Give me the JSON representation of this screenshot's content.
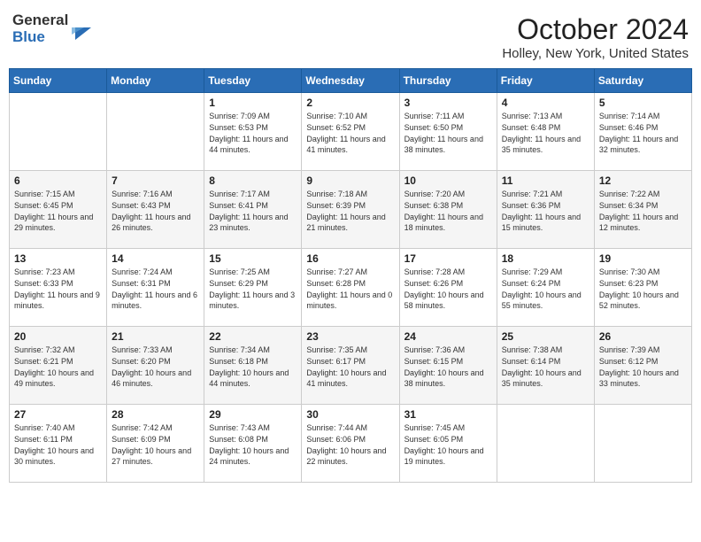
{
  "header": {
    "logo_general": "General",
    "logo_blue": "Blue",
    "month": "October 2024",
    "location": "Holley, New York, United States"
  },
  "weekdays": [
    "Sunday",
    "Monday",
    "Tuesday",
    "Wednesday",
    "Thursday",
    "Friday",
    "Saturday"
  ],
  "weeks": [
    [
      {
        "day": "",
        "sunrise": "",
        "sunset": "",
        "daylight": ""
      },
      {
        "day": "",
        "sunrise": "",
        "sunset": "",
        "daylight": ""
      },
      {
        "day": "1",
        "sunrise": "Sunrise: 7:09 AM",
        "sunset": "Sunset: 6:53 PM",
        "daylight": "Daylight: 11 hours and 44 minutes."
      },
      {
        "day": "2",
        "sunrise": "Sunrise: 7:10 AM",
        "sunset": "Sunset: 6:52 PM",
        "daylight": "Daylight: 11 hours and 41 minutes."
      },
      {
        "day": "3",
        "sunrise": "Sunrise: 7:11 AM",
        "sunset": "Sunset: 6:50 PM",
        "daylight": "Daylight: 11 hours and 38 minutes."
      },
      {
        "day": "4",
        "sunrise": "Sunrise: 7:13 AM",
        "sunset": "Sunset: 6:48 PM",
        "daylight": "Daylight: 11 hours and 35 minutes."
      },
      {
        "day": "5",
        "sunrise": "Sunrise: 7:14 AM",
        "sunset": "Sunset: 6:46 PM",
        "daylight": "Daylight: 11 hours and 32 minutes."
      }
    ],
    [
      {
        "day": "6",
        "sunrise": "Sunrise: 7:15 AM",
        "sunset": "Sunset: 6:45 PM",
        "daylight": "Daylight: 11 hours and 29 minutes."
      },
      {
        "day": "7",
        "sunrise": "Sunrise: 7:16 AM",
        "sunset": "Sunset: 6:43 PM",
        "daylight": "Daylight: 11 hours and 26 minutes."
      },
      {
        "day": "8",
        "sunrise": "Sunrise: 7:17 AM",
        "sunset": "Sunset: 6:41 PM",
        "daylight": "Daylight: 11 hours and 23 minutes."
      },
      {
        "day": "9",
        "sunrise": "Sunrise: 7:18 AM",
        "sunset": "Sunset: 6:39 PM",
        "daylight": "Daylight: 11 hours and 21 minutes."
      },
      {
        "day": "10",
        "sunrise": "Sunrise: 7:20 AM",
        "sunset": "Sunset: 6:38 PM",
        "daylight": "Daylight: 11 hours and 18 minutes."
      },
      {
        "day": "11",
        "sunrise": "Sunrise: 7:21 AM",
        "sunset": "Sunset: 6:36 PM",
        "daylight": "Daylight: 11 hours and 15 minutes."
      },
      {
        "day": "12",
        "sunrise": "Sunrise: 7:22 AM",
        "sunset": "Sunset: 6:34 PM",
        "daylight": "Daylight: 11 hours and 12 minutes."
      }
    ],
    [
      {
        "day": "13",
        "sunrise": "Sunrise: 7:23 AM",
        "sunset": "Sunset: 6:33 PM",
        "daylight": "Daylight: 11 hours and 9 minutes."
      },
      {
        "day": "14",
        "sunrise": "Sunrise: 7:24 AM",
        "sunset": "Sunset: 6:31 PM",
        "daylight": "Daylight: 11 hours and 6 minutes."
      },
      {
        "day": "15",
        "sunrise": "Sunrise: 7:25 AM",
        "sunset": "Sunset: 6:29 PM",
        "daylight": "Daylight: 11 hours and 3 minutes."
      },
      {
        "day": "16",
        "sunrise": "Sunrise: 7:27 AM",
        "sunset": "Sunset: 6:28 PM",
        "daylight": "Daylight: 11 hours and 0 minutes."
      },
      {
        "day": "17",
        "sunrise": "Sunrise: 7:28 AM",
        "sunset": "Sunset: 6:26 PM",
        "daylight": "Daylight: 10 hours and 58 minutes."
      },
      {
        "day": "18",
        "sunrise": "Sunrise: 7:29 AM",
        "sunset": "Sunset: 6:24 PM",
        "daylight": "Daylight: 10 hours and 55 minutes."
      },
      {
        "day": "19",
        "sunrise": "Sunrise: 7:30 AM",
        "sunset": "Sunset: 6:23 PM",
        "daylight": "Daylight: 10 hours and 52 minutes."
      }
    ],
    [
      {
        "day": "20",
        "sunrise": "Sunrise: 7:32 AM",
        "sunset": "Sunset: 6:21 PM",
        "daylight": "Daylight: 10 hours and 49 minutes."
      },
      {
        "day": "21",
        "sunrise": "Sunrise: 7:33 AM",
        "sunset": "Sunset: 6:20 PM",
        "daylight": "Daylight: 10 hours and 46 minutes."
      },
      {
        "day": "22",
        "sunrise": "Sunrise: 7:34 AM",
        "sunset": "Sunset: 6:18 PM",
        "daylight": "Daylight: 10 hours and 44 minutes."
      },
      {
        "day": "23",
        "sunrise": "Sunrise: 7:35 AM",
        "sunset": "Sunset: 6:17 PM",
        "daylight": "Daylight: 10 hours and 41 minutes."
      },
      {
        "day": "24",
        "sunrise": "Sunrise: 7:36 AM",
        "sunset": "Sunset: 6:15 PM",
        "daylight": "Daylight: 10 hours and 38 minutes."
      },
      {
        "day": "25",
        "sunrise": "Sunrise: 7:38 AM",
        "sunset": "Sunset: 6:14 PM",
        "daylight": "Daylight: 10 hours and 35 minutes."
      },
      {
        "day": "26",
        "sunrise": "Sunrise: 7:39 AM",
        "sunset": "Sunset: 6:12 PM",
        "daylight": "Daylight: 10 hours and 33 minutes."
      }
    ],
    [
      {
        "day": "27",
        "sunrise": "Sunrise: 7:40 AM",
        "sunset": "Sunset: 6:11 PM",
        "daylight": "Daylight: 10 hours and 30 minutes."
      },
      {
        "day": "28",
        "sunrise": "Sunrise: 7:42 AM",
        "sunset": "Sunset: 6:09 PM",
        "daylight": "Daylight: 10 hours and 27 minutes."
      },
      {
        "day": "29",
        "sunrise": "Sunrise: 7:43 AM",
        "sunset": "Sunset: 6:08 PM",
        "daylight": "Daylight: 10 hours and 24 minutes."
      },
      {
        "day": "30",
        "sunrise": "Sunrise: 7:44 AM",
        "sunset": "Sunset: 6:06 PM",
        "daylight": "Daylight: 10 hours and 22 minutes."
      },
      {
        "day": "31",
        "sunrise": "Sunrise: 7:45 AM",
        "sunset": "Sunset: 6:05 PM",
        "daylight": "Daylight: 10 hours and 19 minutes."
      },
      {
        "day": "",
        "sunrise": "",
        "sunset": "",
        "daylight": ""
      },
      {
        "day": "",
        "sunrise": "",
        "sunset": "",
        "daylight": ""
      }
    ]
  ]
}
